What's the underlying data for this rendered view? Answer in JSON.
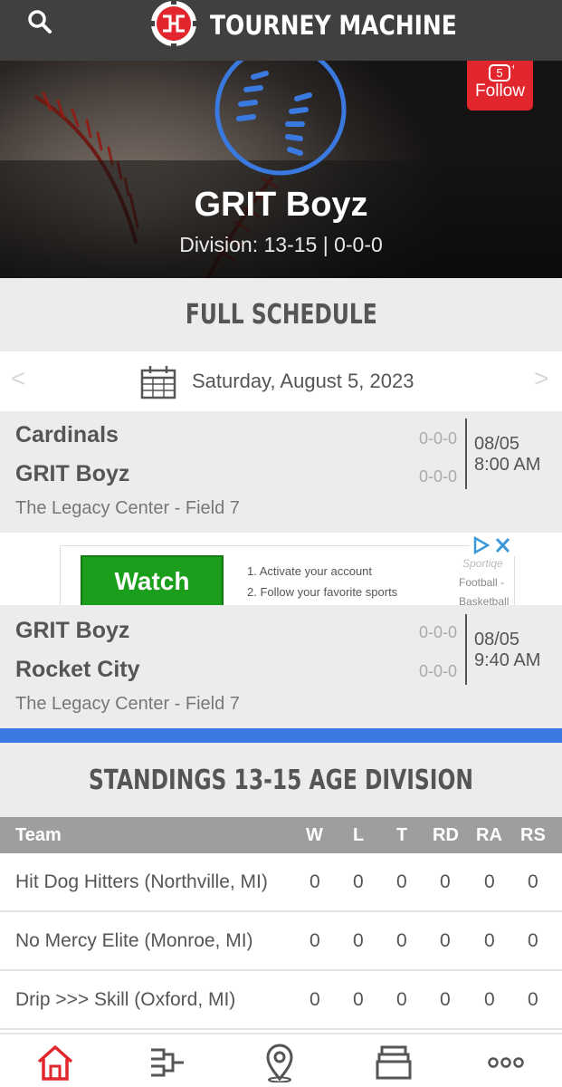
{
  "app": {
    "name": "TOURNEY MACHINE"
  },
  "header": {
    "search_icon": "search-icon",
    "logo_icon": "tourney-machine-logo"
  },
  "hero": {
    "team_name": "GRIT Boyz",
    "division": "Division: 13-15 | 0-0-0",
    "follow": {
      "count": "5",
      "label": "Follow"
    }
  },
  "schedule": {
    "title": "FULL SCHEDULE",
    "prev": "<",
    "next": ">",
    "date": "Saturday, August 5, 2023",
    "games": [
      {
        "team1": "Cardinals",
        "team1_record": "0-0-0",
        "team2": "GRIT Boyz",
        "team2_record": "0-0-0",
        "date": "08/05",
        "time": "8:00 AM",
        "location": "The Legacy Center - Field 7"
      },
      {
        "team1": "GRIT Boyz",
        "team1_record": "0-0-0",
        "team2": "Rocket City",
        "team2_record": "0-0-0",
        "date": "08/05",
        "time": "9:40 AM",
        "location": "The Legacy Center - Field 7"
      }
    ]
  },
  "ad": {
    "button": "Watch",
    "steps": [
      "1. Activate your account",
      "2. Follow your favorite sports"
    ],
    "brand": "Sportiqe",
    "sub1": "Football -",
    "sub2": "Basketball"
  },
  "standings": {
    "title": "STANDINGS 13-15 AGE DIVISION",
    "columns": [
      "Team",
      "W",
      "L",
      "T",
      "RD",
      "RA",
      "RS"
    ],
    "rows": [
      [
        "Hit Dog Hitters (Northville, MI)",
        "0",
        "0",
        "0",
        "0",
        "0",
        "0"
      ],
      [
        "No Mercy Elite (Monroe, MI)",
        "0",
        "0",
        "0",
        "0",
        "0",
        "0"
      ],
      [
        "Drip >>> Skill (Oxford, MI)",
        "0",
        "0",
        "0",
        "0",
        "0",
        "0"
      ]
    ]
  },
  "colors": {
    "accent": "#e1262d",
    "blue": "#3a7ae0",
    "header_bg": "#404040"
  },
  "bottom_nav": [
    "home-icon",
    "bracket-icon",
    "location-icon",
    "schedule-icon",
    "more-icon"
  ]
}
